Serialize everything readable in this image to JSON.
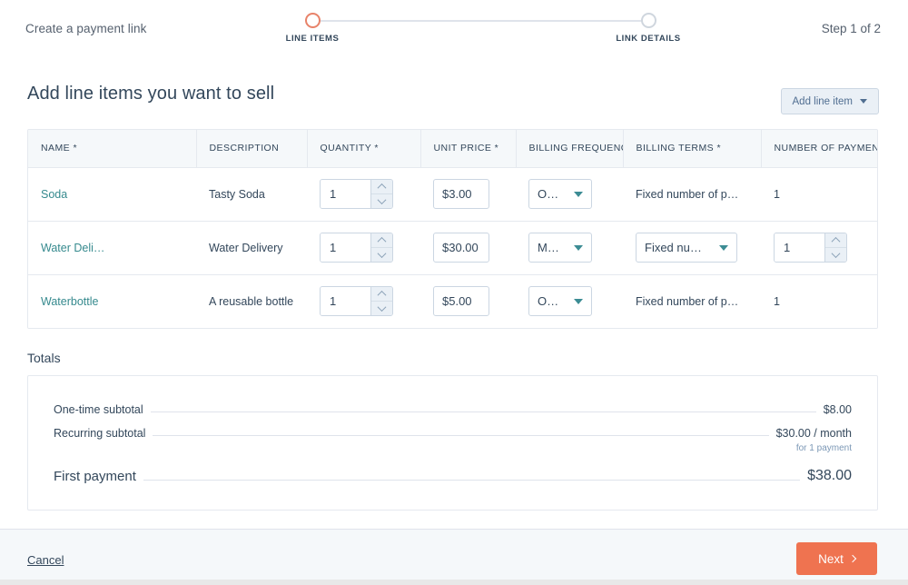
{
  "header": {
    "title": "Create a payment link",
    "step_count": "Step 1 of 2",
    "steps": [
      {
        "label": "LINE ITEMS",
        "state": "active"
      },
      {
        "label": "LINK DETAILS",
        "state": "inactive"
      }
    ]
  },
  "main": {
    "section_title": "Add line items you want to sell",
    "add_line_item_label": "Add line item"
  },
  "table": {
    "columns": [
      "NAME *",
      "DESCRIPTION",
      "QUANTITY *",
      "UNIT PRICE *",
      "BILLING FREQUENCY",
      "BILLING TERMS *",
      "NUMBER OF PAYMENTS"
    ],
    "rows": [
      {
        "name": "Soda",
        "description": "Tasty Soda",
        "quantity": "1",
        "unit_price": "$3.00",
        "billing_frequency": "O…",
        "billing_terms": "Fixed number of p…",
        "billing_terms_type": "text",
        "number_of_payments": "1",
        "number_of_payments_type": "text"
      },
      {
        "name": "Water Deli…",
        "description": "Water Delivery",
        "quantity": "1",
        "unit_price": "$30.00",
        "billing_frequency": "M…",
        "billing_terms": "Fixed nu…",
        "billing_terms_type": "select",
        "number_of_payments": "1",
        "number_of_payments_type": "stepper"
      },
      {
        "name": "Waterbottle",
        "description": "A reusable bottle",
        "quantity": "1",
        "unit_price": "$5.00",
        "billing_frequency": "O…",
        "billing_terms": "Fixed number of p…",
        "billing_terms_type": "text",
        "number_of_payments": "1",
        "number_of_payments_type": "text"
      }
    ]
  },
  "totals": {
    "heading": "Totals",
    "rows": [
      {
        "label": "One-time subtotal",
        "value": "$8.00",
        "note": ""
      },
      {
        "label": "Recurring subtotal",
        "value": "$30.00 / month",
        "note": "for 1 payment"
      },
      {
        "label": "First payment",
        "value": "$38.00",
        "note": ""
      }
    ]
  },
  "footer": {
    "cancel_label": "Cancel",
    "next_label": "Next"
  },
  "colors": {
    "accent_orange": "#ef7350",
    "step_active": "#e8836a",
    "link_teal": "#368A8E",
    "caret_teal": "#3c8c94",
    "header_bg": "#f5f8fa",
    "border": "#e5e9ef",
    "text": "#33475b"
  }
}
